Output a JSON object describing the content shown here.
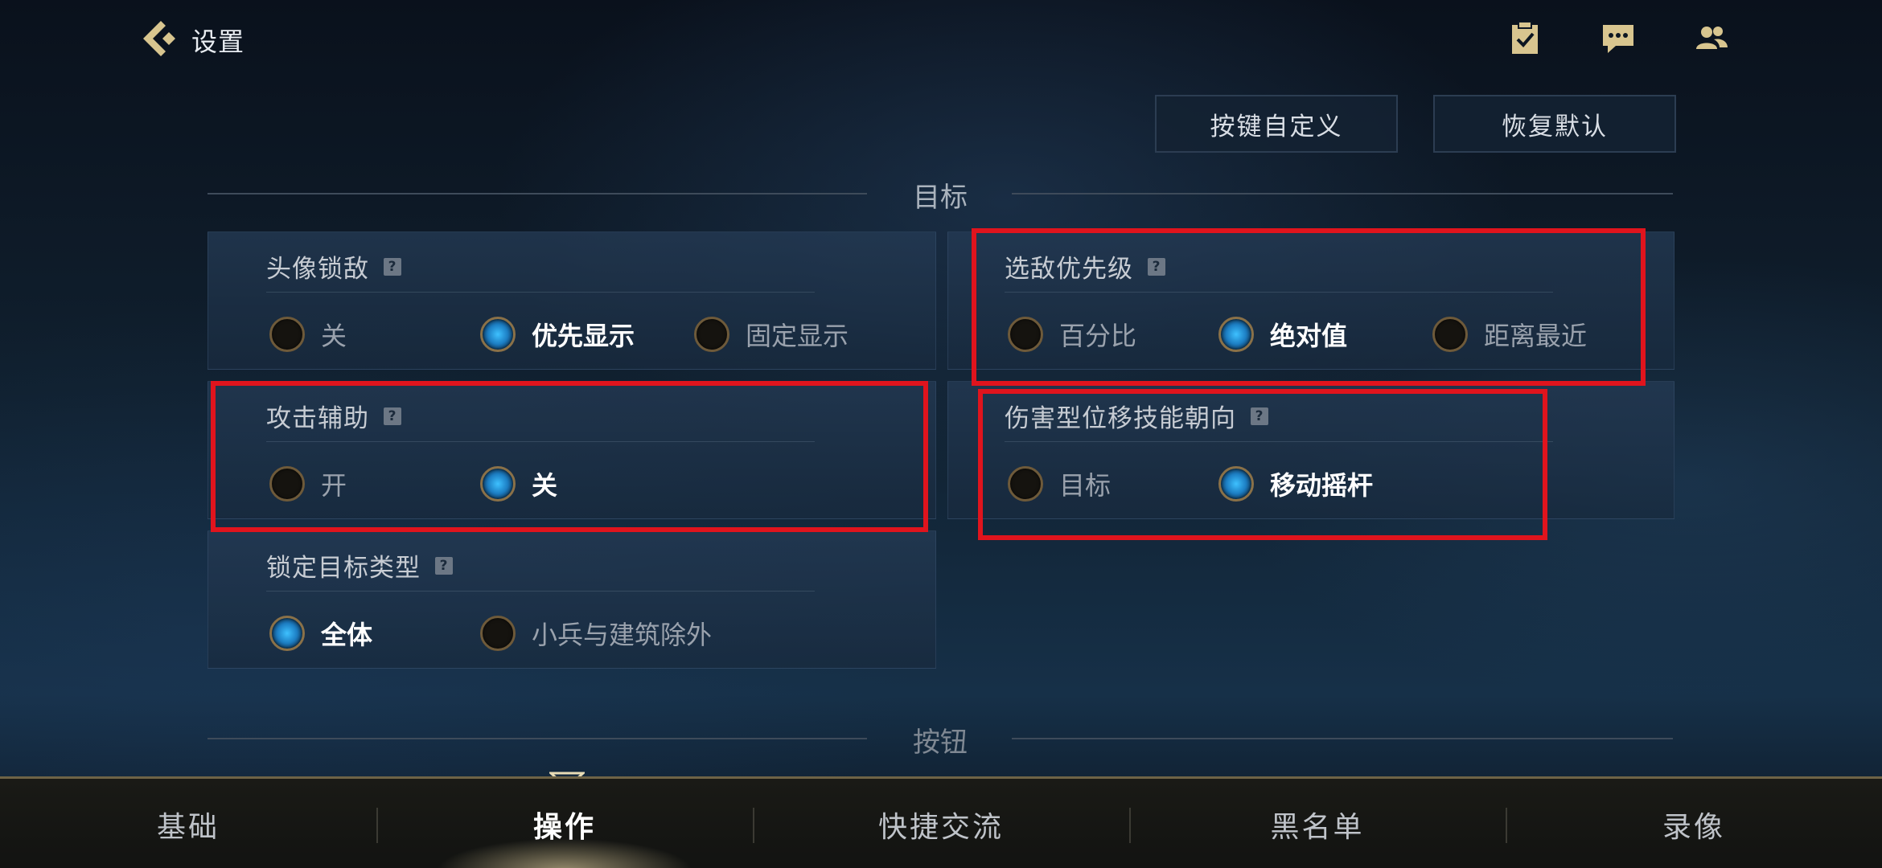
{
  "header": {
    "title": "设置"
  },
  "actions": {
    "custom_keys": "按键自定义",
    "restore_default": "恢复默认"
  },
  "sections": {
    "target": "目标",
    "buttons": "按钮"
  },
  "panels": {
    "avatar_lock": {
      "title": "头像锁敌",
      "options": [
        "关",
        "优先显示",
        "固定显示"
      ],
      "selected": "优先显示"
    },
    "enemy_priority": {
      "title": "选敌优先级",
      "options": [
        "百分比",
        "绝对值",
        "距离最近"
      ],
      "selected": "绝对值"
    },
    "attack_assist": {
      "title": "攻击辅助",
      "options": [
        "开",
        "关"
      ],
      "selected": "关"
    },
    "damage_dash_direction": {
      "title": "伤害型位移技能朝向",
      "options": [
        "目标",
        "移动摇杆"
      ],
      "selected": "移动摇杆"
    },
    "lock_target_type": {
      "title": "锁定目标类型",
      "options": [
        "全体",
        "小兵与建筑除外"
      ],
      "selected": "全体"
    }
  },
  "tabs": [
    {
      "label": "基础",
      "active": false
    },
    {
      "label": "操作",
      "active": true
    },
    {
      "label": "快捷交流",
      "active": false
    },
    {
      "label": "黑名单",
      "active": false
    },
    {
      "label": "录像",
      "active": false
    }
  ],
  "icons": {
    "back": "back-arrow-icon",
    "task": "clipboard-check-icon",
    "chat": "chat-bubble-icon",
    "friends": "friends-icon",
    "help": "help-icon"
  },
  "colors": {
    "highlight_box": "#e0141d",
    "radio_selected": "#3ec1ff",
    "accent_gold": "#c9b27a"
  }
}
